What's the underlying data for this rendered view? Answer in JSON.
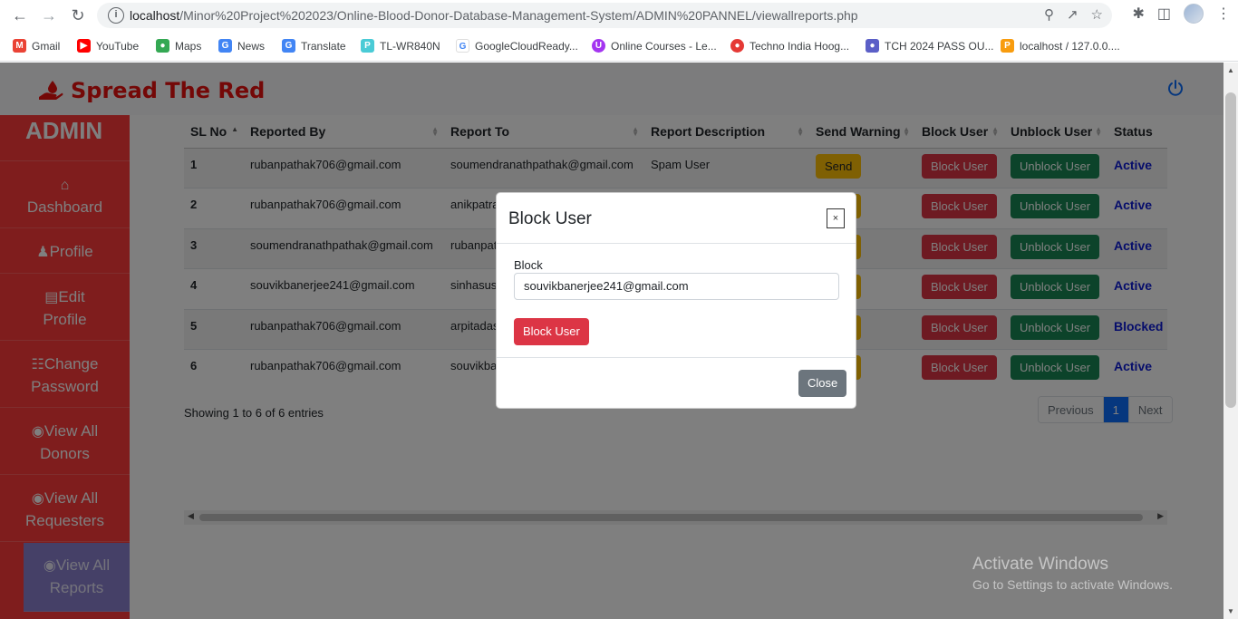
{
  "browser": {
    "url_host": "localhost",
    "url_path": "/Minor%20Project%202023/Online-Blood-Donor-Database-Management-System/ADMIN%20PANNEL/viewallreports.php",
    "bookmarks": [
      {
        "label": "Gmail",
        "icon": "gmail-icon",
        "color": "#ea4335"
      },
      {
        "label": "YouTube",
        "icon": "youtube-icon",
        "color": "#ff0000"
      },
      {
        "label": "Maps",
        "icon": "maps-icon",
        "color": "#34a853"
      },
      {
        "label": "News",
        "icon": "news-icon",
        "color": "#4285f4"
      },
      {
        "label": "Translate",
        "icon": "translate-icon",
        "color": "#4285f4"
      },
      {
        "label": "TL-WR840N",
        "icon": "tplink-icon",
        "color": "#4acbd6"
      },
      {
        "label": "GoogleCloudReady...",
        "icon": "google-icon",
        "color": "#4285f4"
      },
      {
        "label": "Online Courses - Le...",
        "icon": "courses-icon",
        "color": "#a435f0"
      },
      {
        "label": "Techno India Hoog...",
        "icon": "techno-icon",
        "color": "#e53935"
      },
      {
        "label": "TCH 2024 PASS OU...",
        "icon": "group-icon",
        "color": "#5b5fc7"
      },
      {
        "label": "localhost / 127.0.0....",
        "icon": "phpmyadmin-icon",
        "color": "#f89c0e"
      }
    ]
  },
  "header": {
    "brand": "Spread The Red",
    "brand_color": "#e8100f"
  },
  "sidebar": {
    "title": "ADMIN",
    "items": [
      {
        "label": "Dashboard",
        "icon": "home-icon"
      },
      {
        "label": "Profile",
        "icon": "user-icon"
      },
      {
        "label": "Edit Profile",
        "line1": "Edit",
        "line2": "Profile",
        "icon": "id-card-icon"
      },
      {
        "label": "Change Password",
        "line1": "Change",
        "line2": "Password",
        "icon": "file-icon"
      },
      {
        "label": "View All Donors",
        "line1": "View All",
        "line2": "Donors",
        "icon": "eye-icon"
      },
      {
        "label": "View All Requesters",
        "line1": "View All",
        "line2": "Requesters",
        "icon": "eye-icon"
      },
      {
        "label": "View All Reports",
        "line1": "View All",
        "line2": "Reports",
        "icon": "eye-icon",
        "active": true
      }
    ]
  },
  "table": {
    "columns": [
      "SL No",
      "Reported By",
      "Report To",
      "Report Description",
      "Send Warning",
      "Block User",
      "Unblock User",
      "Status"
    ],
    "rows": [
      {
        "sl": "1",
        "by": "rubanpathak706@gmail.com",
        "to": "soumendranathpathak@gmail.com",
        "desc": "Spam User",
        "status": "Active"
      },
      {
        "sl": "2",
        "by": "rubanpathak706@gmail.com",
        "to": "anikpatra",
        "desc": "",
        "status": "Active"
      },
      {
        "sl": "3",
        "by": "soumendranathpathak@gmail.com",
        "to": "rubanpat",
        "desc": "",
        "status": "Active"
      },
      {
        "sl": "4",
        "by": "souvikbanerjee241@gmail.com",
        "to": "sinhasusr",
        "desc": "",
        "status": "Active"
      },
      {
        "sl": "5",
        "by": "rubanpathak706@gmail.com",
        "to": "arpitadas",
        "desc": "",
        "status": "Blocked"
      },
      {
        "sl": "6",
        "by": "rubanpathak706@gmail.com",
        "to": "souvikba",
        "desc": "",
        "status": "Active"
      }
    ],
    "send_label": "Send",
    "block_label": "Block User",
    "unblock_label": "Unblock User",
    "showing": "Showing 1 to 6 of 6 entries",
    "pager": {
      "prev": "Previous",
      "current": "1",
      "next": "Next"
    }
  },
  "modal": {
    "title": "Block User",
    "close_x": "×",
    "field_label": "Block",
    "field_value": "souvikbanerjee241@gmail.com",
    "submit": "Block User",
    "close": "Close"
  },
  "watermark": {
    "line1": "Activate Windows",
    "line2": "Go to Settings to activate Windows."
  }
}
